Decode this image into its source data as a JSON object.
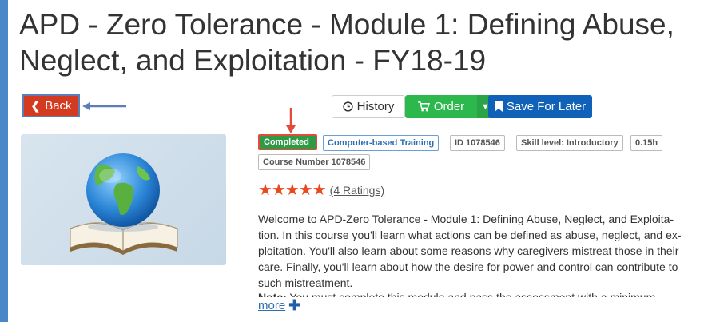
{
  "page": {
    "title": "APD - Zero Tolerance - Module 1: Defining Abuse, Neglect, and Exploitation - FY18-19",
    "title_line1": "APD - Zero Tolerance - Module 1: Defining Abuse,",
    "title_line2": "Neglect, and Exploitation - FY18-19"
  },
  "actions": {
    "back_label": "Back",
    "history_label": "History",
    "order_label": "Order",
    "save_label": "Save For Later"
  },
  "badges": {
    "status": "Completed",
    "type": "Computer-based Training",
    "id": "ID 1078546",
    "skill": "Skill level: Introductory",
    "hours": "0.15h",
    "course_number": "Course Number 1078546"
  },
  "rating": {
    "stars": 5,
    "max": 5,
    "link_text": "(4 Ratings)"
  },
  "description": {
    "line1": "Welcome to APD-Zero Tolerance - Module 1: Defining Abuse, Neglect, and Exploita-",
    "line2": "tion. In this course you'll learn what actions can be defined as abuse, neglect, and ex-",
    "line3": "ploitation. You'll also learn about some reasons why caregivers mistreat those in their",
    "line4": "care. Finally, you'll learn about how the desire for power and control can contribute to",
    "line5": "such mistreatment.",
    "note_label": "Note:",
    "note_text": " You must complete this module and pass the assessment with a minimum"
  },
  "more_label": "more",
  "colors": {
    "frame": "#4a87c8",
    "back": "#d33a1f",
    "order": "#2db84d",
    "save": "#1062b8",
    "completed": "#2e9a45",
    "stars": "#e8491d",
    "annotation_arrow_red": "#e24a3a",
    "annotation_arrow_blue": "#5a7fb8"
  },
  "icons": {
    "back": "chevron-left-icon",
    "history": "clock-icon",
    "order": "cart-icon",
    "order_caret": "caret-down-icon",
    "save": "bookmark-icon",
    "more": "plus-icon",
    "cover": "globe-on-open-book-image"
  }
}
